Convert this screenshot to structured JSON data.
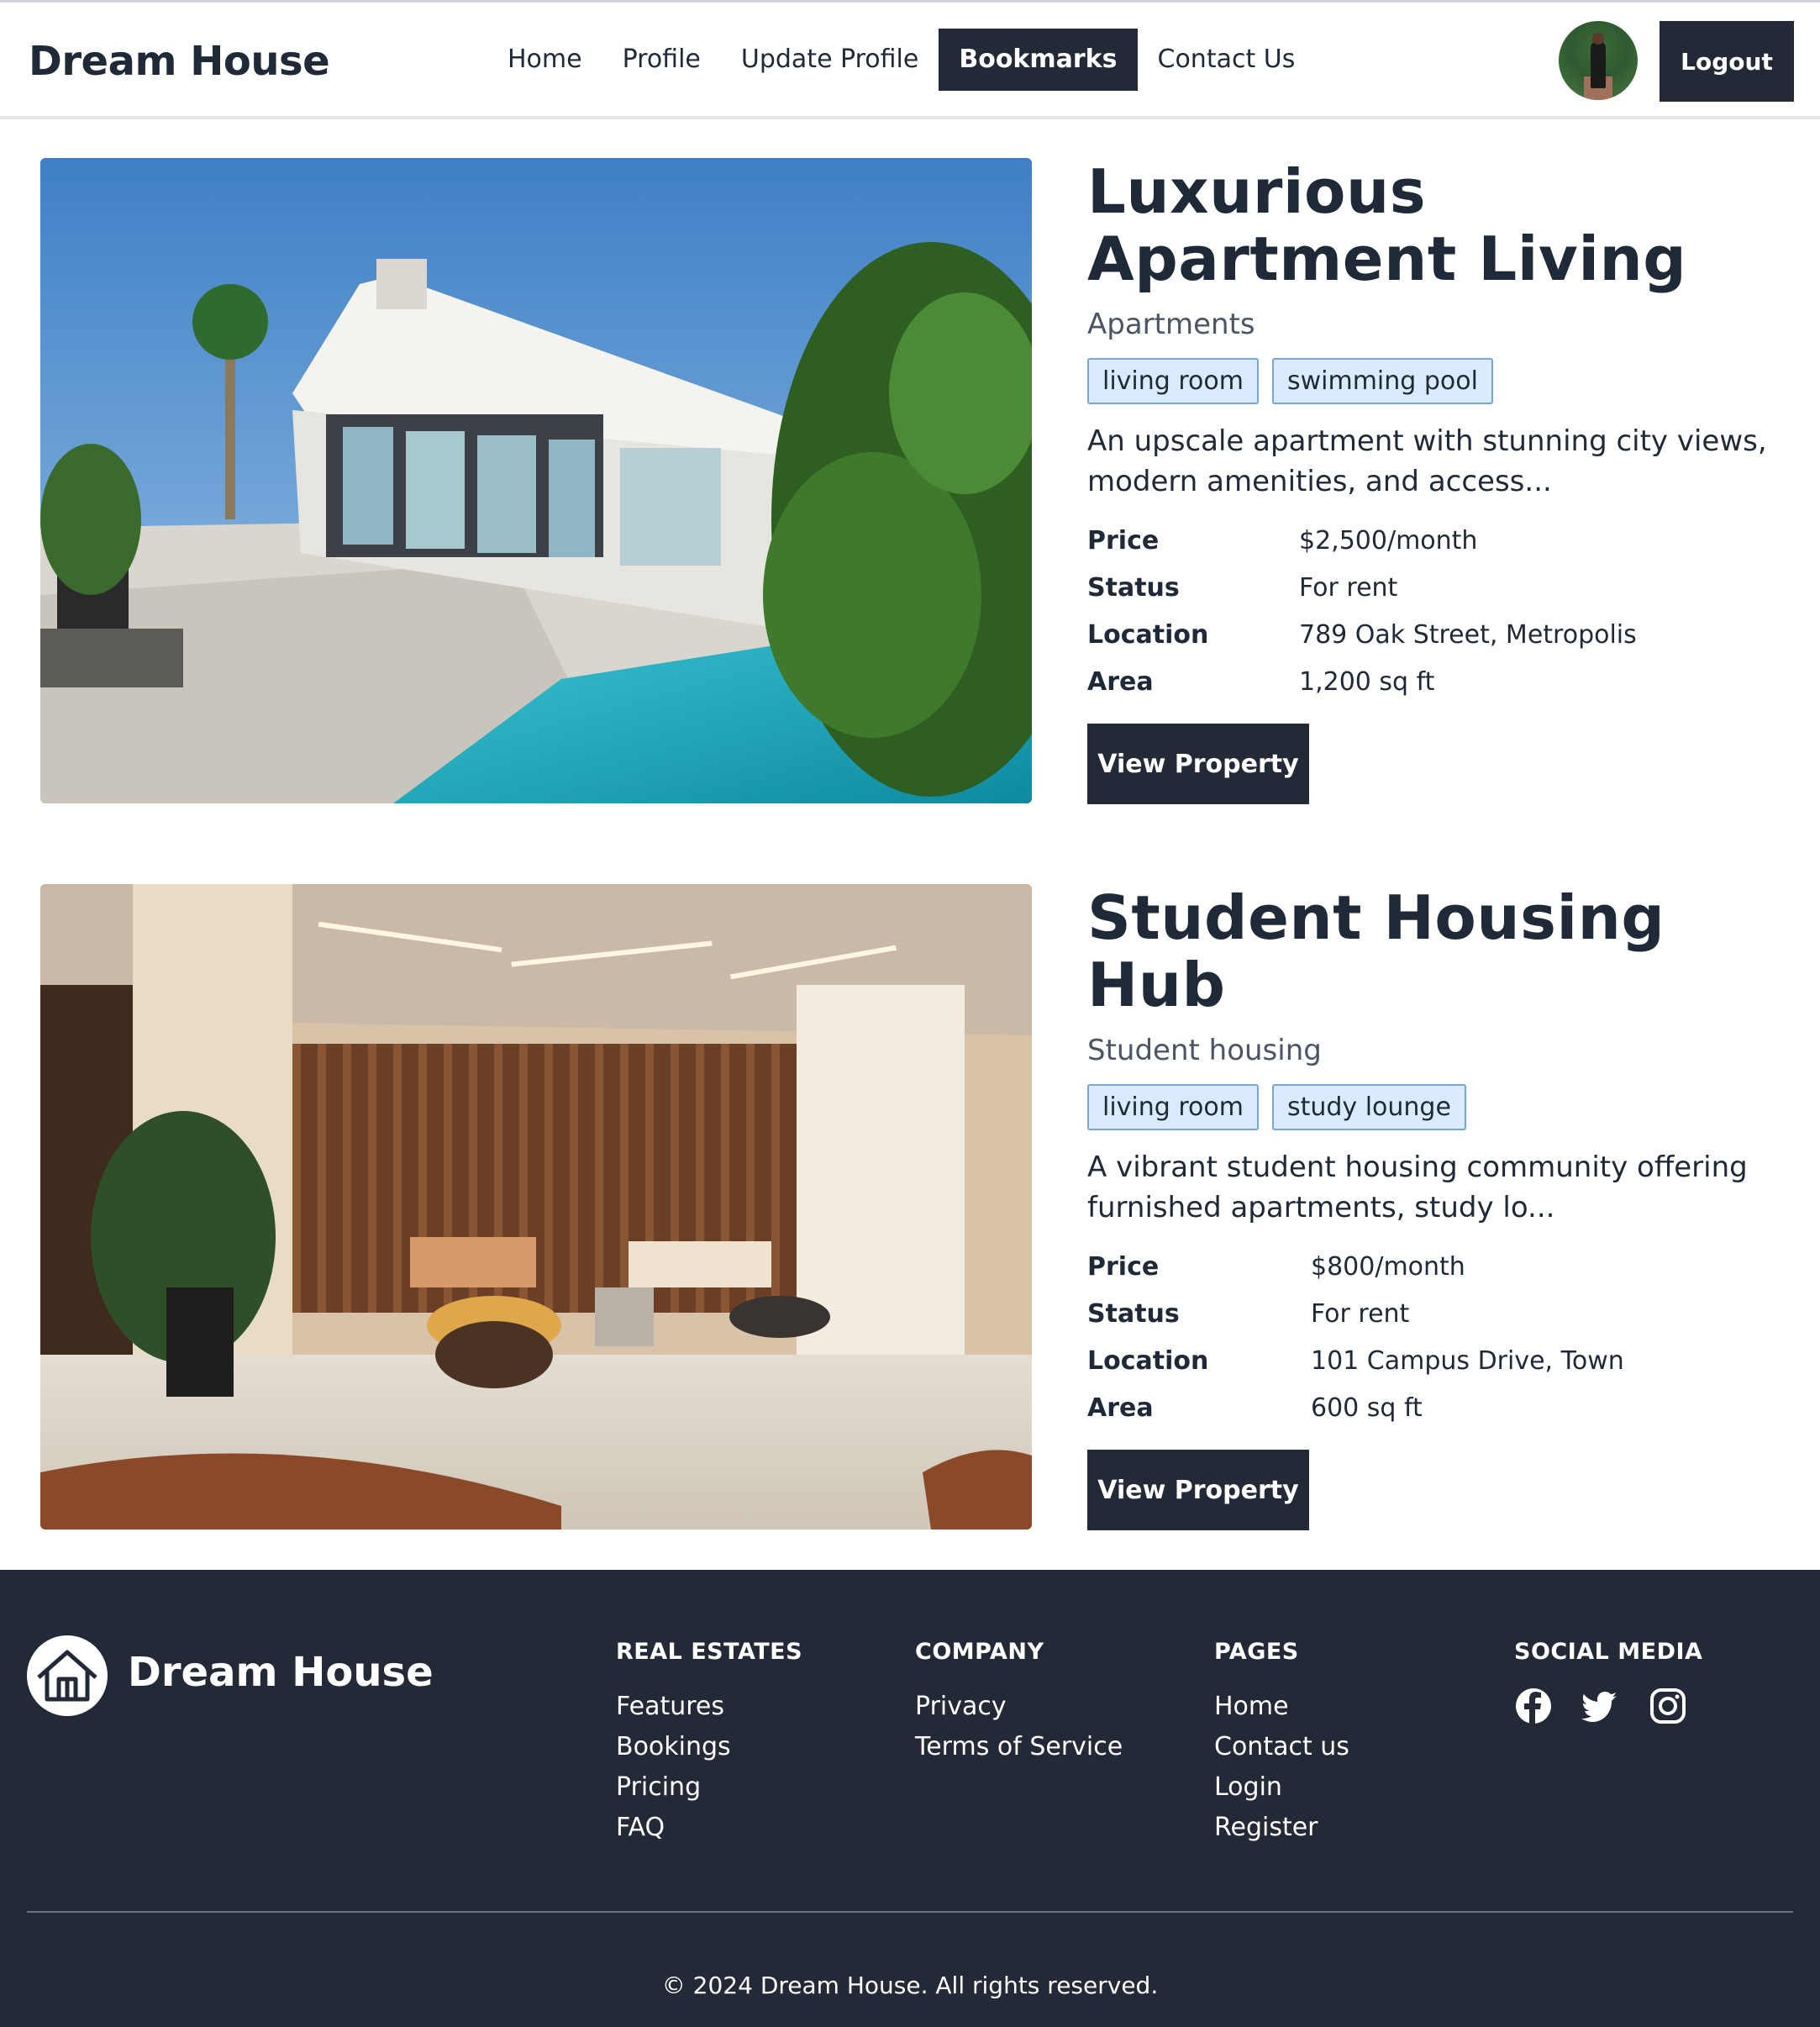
{
  "brand": "Dream House",
  "nav": {
    "links": [
      "Home",
      "Profile",
      "Update Profile",
      "Bookmarks",
      "Contact Us"
    ],
    "active_index": 3,
    "logout_label": "Logout"
  },
  "listings": [
    {
      "title": "Luxurious Apartment Living",
      "category": "Apartments",
      "tags": [
        "living room",
        "swimming pool"
      ],
      "description": "An upscale apartment with stunning city views, modern amenities, and access...",
      "specs": [
        {
          "label": "Price",
          "value": "$2,500/month"
        },
        {
          "label": "Status",
          "value": "For rent"
        },
        {
          "label": "Location",
          "value": "789 Oak Street, Metropolis"
        },
        {
          "label": "Area",
          "value": "1,200 sq ft"
        }
      ],
      "button_label": "View Property"
    },
    {
      "title": "Student Housing Hub",
      "category": "Student housing",
      "tags": [
        "living room",
        "study lounge"
      ],
      "description": "A vibrant student housing community offering furnished apartments, study lo...",
      "specs": [
        {
          "label": "Price",
          "value": "$800/month"
        },
        {
          "label": "Status",
          "value": "For rent"
        },
        {
          "label": "Location",
          "value": "101 Campus Drive, Town"
        },
        {
          "label": "Area",
          "value": "600 sq ft"
        }
      ],
      "button_label": "View Property"
    }
  ],
  "footer": {
    "brand": "Dream House",
    "columns": [
      {
        "heading": "REAL ESTATES",
        "links": [
          "Features",
          "Bookings",
          "Pricing",
          "FAQ"
        ]
      },
      {
        "heading": "COMPANY",
        "links": [
          "Privacy",
          "Terms of Service"
        ]
      },
      {
        "heading": "PAGES",
        "links": [
          "Home",
          "Contact us",
          "Login",
          "Register"
        ]
      }
    ],
    "social_heading": "SOCIAL MEDIA",
    "social_icons": [
      "facebook-icon",
      "twitter-icon",
      "instagram-icon"
    ],
    "copyright": "© 2024 Dream House. All rights reserved."
  },
  "colors": {
    "primary_dark": "#232936",
    "tag_bg": "#dbeafe",
    "tag_border": "#7aa6d4",
    "text": "#1f2937",
    "muted": "#4b5563"
  }
}
